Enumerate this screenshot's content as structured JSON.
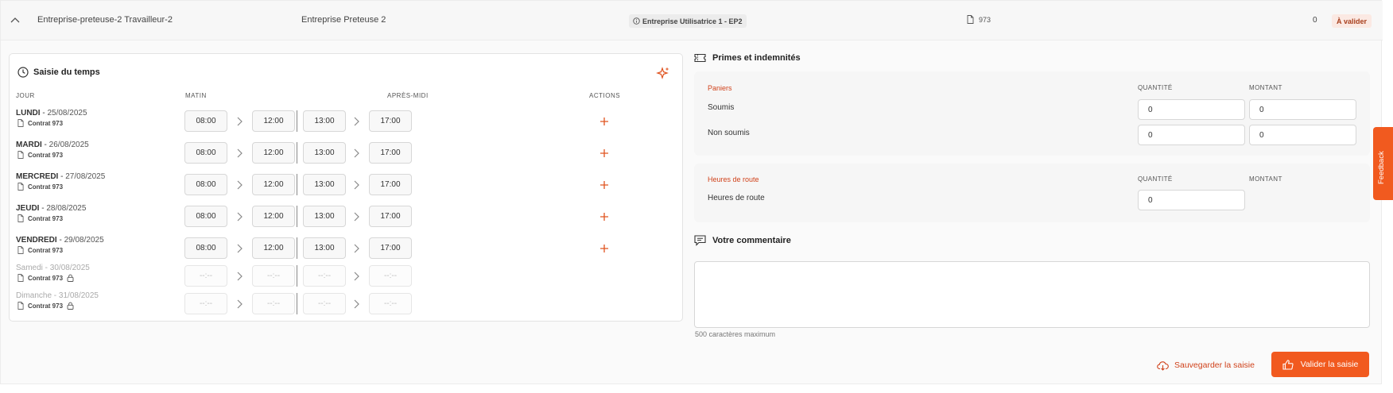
{
  "row": {
    "worker": "Entreprise-preteuse-2 Travailleur-2",
    "company": "Entreprise Preteuse 2",
    "user_company": "Entreprise Utilisatrice 1 - EP2",
    "contract": "973",
    "count": "0",
    "status": "À valider"
  },
  "time": {
    "title": "Saisie du temps",
    "col_day": "JOUR",
    "col_morning": "MATIN",
    "col_afternoon": "APRÈS-MIDI",
    "col_actions": "ACTIONS",
    "days": [
      {
        "name": "LUNDI",
        "sep": " - ",
        "date": "25/08/2025",
        "contract": "Contrat 973",
        "t1": "08:00",
        "t2": "12:00",
        "t3": "13:00",
        "t4": "17:00"
      },
      {
        "name": "MARDI",
        "sep": " - ",
        "date": "26/08/2025",
        "contract": "Contrat 973",
        "t1": "08:00",
        "t2": "12:00",
        "t3": "13:00",
        "t4": "17:00"
      },
      {
        "name": "MERCREDI",
        "sep": " - ",
        "date": "27/08/2025",
        "contract": "Contrat 973",
        "t1": "08:00",
        "t2": "12:00",
        "t3": "13:00",
        "t4": "17:00"
      },
      {
        "name": "JEUDI",
        "sep": " - ",
        "date": "28/08/2025",
        "contract": "Contrat 973",
        "t1": "08:00",
        "t2": "12:00",
        "t3": "13:00",
        "t4": "17:00"
      },
      {
        "name": "VENDREDI",
        "sep": " - ",
        "date": "29/08/2025",
        "contract": "Contrat 973",
        "t1": "08:00",
        "t2": "12:00",
        "t3": "13:00",
        "t4": "17:00"
      },
      {
        "name": "Samedi",
        "sep": " - ",
        "date": "30/08/2025",
        "contract": "Contrat 973",
        "t1": "--:--",
        "t2": "--:--",
        "t3": "--:--",
        "t4": "--:--"
      },
      {
        "name": "Dimanche",
        "sep": " - ",
        "date": "31/08/2025",
        "contract": "Contrat 973",
        "t1": "--:--",
        "t2": "--:--",
        "t3": "--:--",
        "t4": "--:--"
      }
    ]
  },
  "primes": {
    "title": "Primes et indemnités",
    "paniers_label": "Paniers",
    "col_quantity": "QUANTITÉ",
    "col_amount": "MONTANT",
    "soumis_label": "Soumis",
    "soumis_qty": "0",
    "soumis_amount": "0",
    "non_soumis_label": "Non soumis",
    "non_soumis_qty": "0",
    "non_soumis_amount": "0",
    "route_section": "Heures de route",
    "route_label": "Heures de route",
    "route_qty": "0"
  },
  "comment": {
    "title": "Votre commentaire",
    "value": "",
    "help": "500 caractères maximum"
  },
  "actions": {
    "save": "Sauvegarder la saisie",
    "validate": "Valider la saisie"
  },
  "feedback": "Feedback",
  "colors": {
    "accent": "#f15a1f",
    "accent_text": "#d0421b"
  }
}
